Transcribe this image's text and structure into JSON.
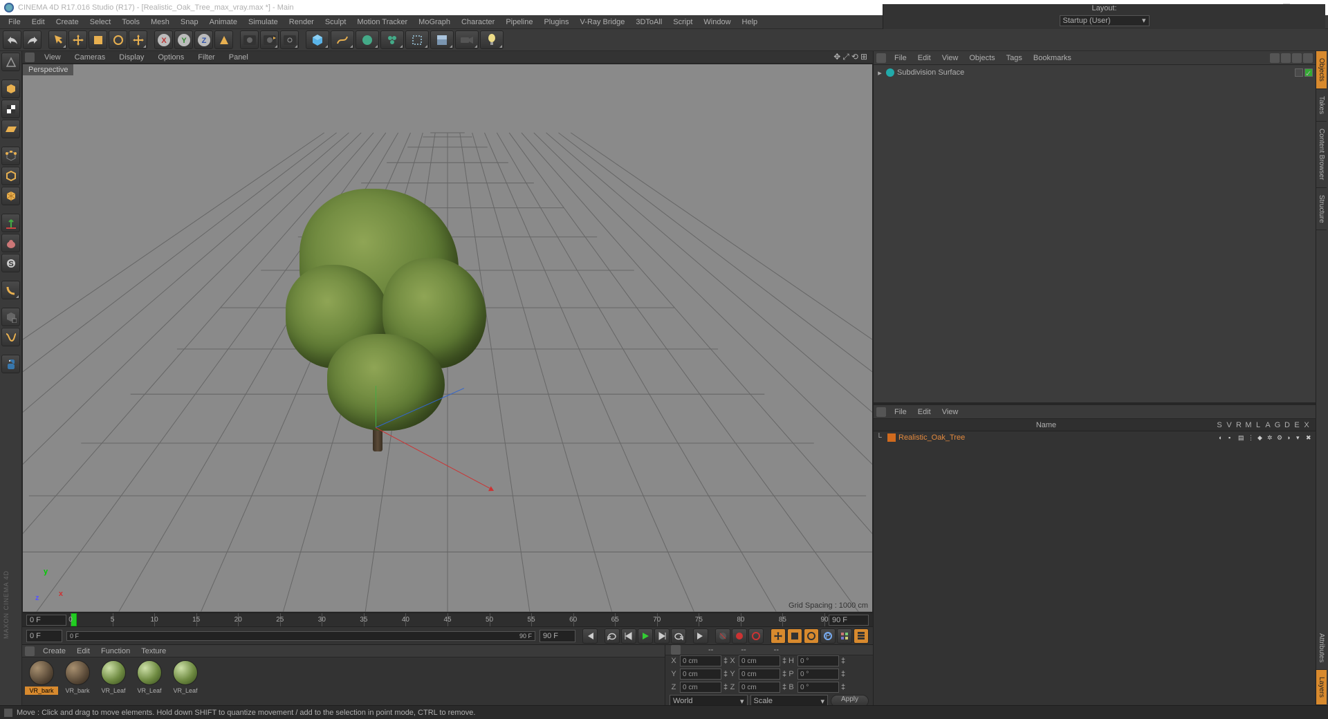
{
  "window": {
    "title": "CINEMA 4D R17.016 Studio (R17) - [Realistic_Oak_Tree_max_vray.max *] - Main",
    "minimize": "—",
    "maximize": "☐",
    "close": "✕"
  },
  "menubar": [
    "File",
    "Edit",
    "Create",
    "Select",
    "Tools",
    "Mesh",
    "Snap",
    "Animate",
    "Simulate",
    "Render",
    "Sculpt",
    "Motion Tracker",
    "MoGraph",
    "Character",
    "Pipeline",
    "Plugins",
    "V-Ray Bridge",
    "3DToAll",
    "Script",
    "Window",
    "Help"
  ],
  "layout": {
    "label": "Layout:",
    "value": "Startup (User)"
  },
  "viewport": {
    "menus": [
      "View",
      "Cameras",
      "Display",
      "Options",
      "Filter",
      "Panel"
    ],
    "label": "Perspective",
    "grid_info": "Grid Spacing : 1000 cm"
  },
  "timeline": {
    "start": "0 F",
    "end": "90 F",
    "slider_min": "0 F",
    "slider_max": "90 F",
    "ticks": [
      0,
      5,
      10,
      15,
      20,
      25,
      30,
      35,
      40,
      45,
      50,
      55,
      60,
      65,
      70,
      75,
      80,
      85,
      90
    ]
  },
  "mat_panel": {
    "menus": [
      "Create",
      "Edit",
      "Function",
      "Texture"
    ],
    "materials": [
      {
        "name": "VR_bark",
        "type": "bark",
        "selected": true
      },
      {
        "name": "VR_bark",
        "type": "bark"
      },
      {
        "name": "VR_Leaf",
        "type": "leaf"
      },
      {
        "name": "VR_Leaf",
        "type": "leaf"
      },
      {
        "name": "VR_Leaf",
        "type": "leaf"
      }
    ]
  },
  "coords": {
    "head": [
      "--",
      "--",
      "--"
    ],
    "rows": [
      {
        "k1": "X",
        "v1": "0 cm",
        "k2": "X",
        "v2": "0 cm",
        "k3": "H",
        "v3": "0 °"
      },
      {
        "k1": "Y",
        "v1": "0 cm",
        "k2": "Y",
        "v2": "0 cm",
        "k3": "P",
        "v3": "0 °"
      },
      {
        "k1": "Z",
        "v1": "0 cm",
        "k2": "Z",
        "v2": "0 cm",
        "k3": "B",
        "v3": "0 °"
      }
    ],
    "combo1": "World",
    "combo2": "Scale",
    "apply": "Apply"
  },
  "objects": {
    "menus": [
      "File",
      "Edit",
      "View",
      "Objects",
      "Tags",
      "Bookmarks"
    ],
    "tree": [
      {
        "name": "Subdivision Surface"
      }
    ]
  },
  "attributes": {
    "menus": [
      "File",
      "Edit",
      "View"
    ],
    "columns": [
      "Name",
      "S",
      "V",
      "R",
      "M",
      "L",
      "A",
      "G",
      "D",
      "E",
      "X"
    ],
    "row": {
      "name": "Realistic_Oak_Tree"
    }
  },
  "vtabs_top": [
    "Objects",
    "Takes",
    "Content Browser",
    "Structure"
  ],
  "vtabs_bot": [
    "Attributes",
    "Layers"
  ],
  "status": "Move : Click and drag to move elements. Hold down SHIFT to quantize movement / add to the selection in point mode, CTRL to remove.",
  "brand": "MAXON CINEMA 4D"
}
